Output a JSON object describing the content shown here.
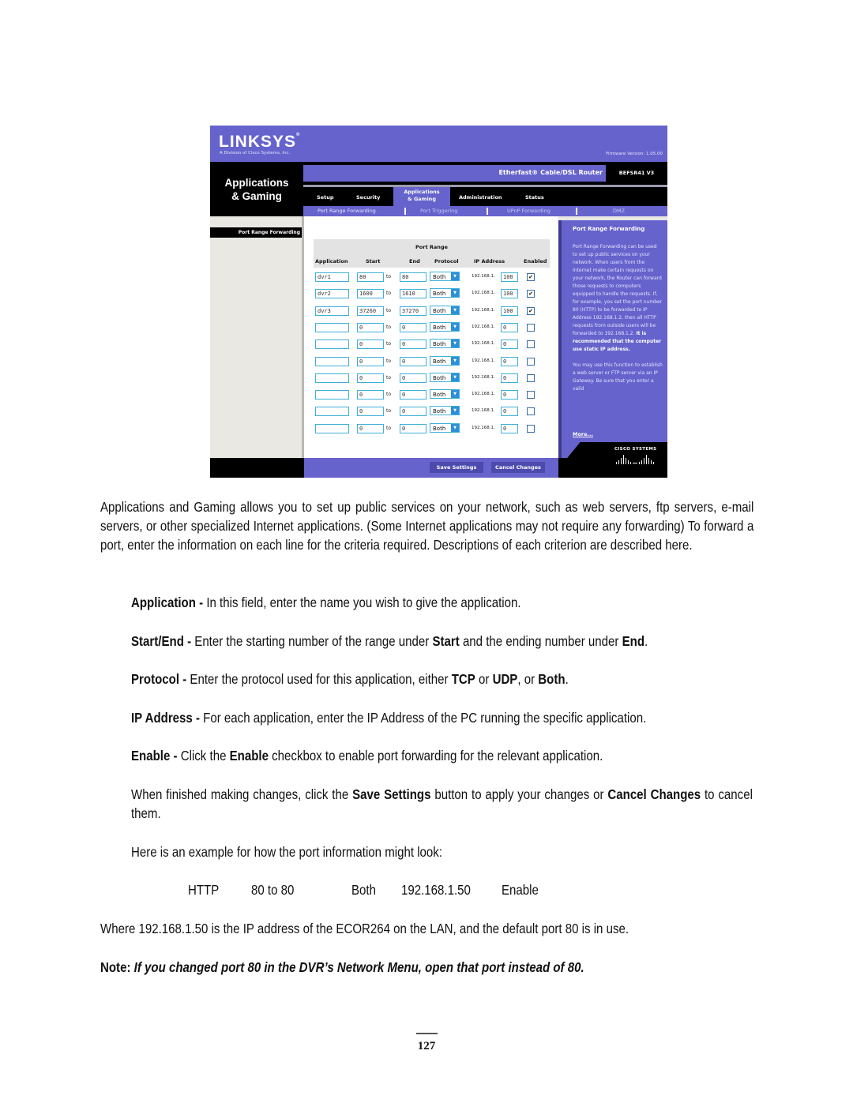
{
  "router_ui": {
    "brand": "LINKSYS",
    "brand_sub": "A Division of Cisco Systems, Inc.",
    "firmware": "Firmware Version: 1.05.00",
    "section_title_line1": "Applications",
    "section_title_line2": "& Gaming",
    "product_name": "Etherfast® Cable/DSL Router",
    "model": "BEFSR41 V3",
    "tabs": [
      {
        "label": "Setup",
        "active": false
      },
      {
        "label": "Security",
        "active": false
      },
      {
        "label_line1": "Applications",
        "label_line2": "& Gaming",
        "active": true
      },
      {
        "label": "Administration",
        "active": false
      },
      {
        "label": "Status",
        "active": false
      }
    ],
    "subtabs": [
      {
        "label": "Port Range Forwarding",
        "active": true
      },
      {
        "label": "Port Triggering",
        "active": false
      },
      {
        "label": "UPnP Forwarding",
        "active": false
      },
      {
        "label": "DMZ",
        "active": false
      }
    ],
    "left_label": "Port Range Forwarding",
    "table": {
      "group_header": "Port Range",
      "columns": [
        "Application",
        "Start",
        "End",
        "Protocol",
        "IP Address",
        "Enabled"
      ],
      "to_label": "to",
      "ip_prefix": "192.168.1.",
      "rows": [
        {
          "application": "dvr1",
          "start": "80",
          "end": "80",
          "protocol": "Both",
          "ip_last": "100",
          "enabled": true
        },
        {
          "application": "dvr2",
          "start": "1600",
          "end": "1610",
          "protocol": "Both",
          "ip_last": "100",
          "enabled": true
        },
        {
          "application": "dvr3",
          "start": "37260",
          "end": "37270",
          "protocol": "Both",
          "ip_last": "100",
          "enabled": true
        },
        {
          "application": "",
          "start": "0",
          "end": "0",
          "protocol": "Both",
          "ip_last": "0",
          "enabled": false
        },
        {
          "application": "",
          "start": "0",
          "end": "0",
          "protocol": "Both",
          "ip_last": "0",
          "enabled": false
        },
        {
          "application": "",
          "start": "0",
          "end": "0",
          "protocol": "Both",
          "ip_last": "0",
          "enabled": false
        },
        {
          "application": "",
          "start": "0",
          "end": "0",
          "protocol": "Both",
          "ip_last": "0",
          "enabled": false
        },
        {
          "application": "",
          "start": "0",
          "end": "0",
          "protocol": "Both",
          "ip_last": "0",
          "enabled": false
        },
        {
          "application": "",
          "start": "0",
          "end": "0",
          "protocol": "Both",
          "ip_last": "0",
          "enabled": false
        },
        {
          "application": "",
          "start": "0",
          "end": "0",
          "protocol": "Both",
          "ip_last": "0",
          "enabled": false
        }
      ]
    },
    "help": {
      "title": "Port Range Forwarding",
      "text_normal": "Port Range Forwarding can be used to set up public services on your network. When users from the Internet make certain requests on your network, the Router can forward those requests to computers equipped to handle the requests. If, for example, you set the port number 80 (HTTP) to be forwarded to IP Address 192.168.1.2, then all HTTP requests from outside users will be forwarded to 192.168.1.2.",
      "text_bold": "It is recommended that the computer use static IP address.",
      "text_2": "You may use this function to establish a web server or FTP server via an IP Gateway. Be sure that you enter a valid",
      "more": "More..."
    },
    "cisco_label": "CISCO SYSTEMS",
    "save_button": "Save Settings",
    "cancel_button": "Cancel Changes",
    "colors": {
      "brand_purple": "#6663cc",
      "header_black": "#000000",
      "field_border": "#3fb0d8"
    }
  },
  "document": {
    "intro": "Applications and Gaming allows you to set up public services on your network, such as web servers, ftp servers, e-mail servers, or other specialized Internet applications. (Some Internet applications may not require any forwarding) To forward a port, enter the information on each line for the criteria required. Descriptions of each criterion are described here.",
    "items": [
      {
        "term": "Application -",
        "text": " In this field, enter the name you wish to give the application."
      },
      {
        "term": "Start/End -",
        "text_a": " Enter the starting number of the range under ",
        "b1": "Start",
        "text_b": " and the ending number under ",
        "b2": "End",
        "text_c": "."
      },
      {
        "term": "Protocol -",
        "text_a": " Enter the protocol used for this application, either ",
        "b1": "TCP",
        "text_b": " or ",
        "b2": "UDP",
        "text_c": ", or ",
        "b3": "Both",
        "text_d": "."
      },
      {
        "term": "IP Address -",
        "text": " For each application, enter the IP Address of the PC running the specific application."
      },
      {
        "term": "Enable -",
        "text_a": " Click the ",
        "b1": "Enable",
        "text_b": " checkbox to enable port forwarding for the relevant application."
      }
    ],
    "finish_a": "When finished making changes, click the ",
    "finish_b1": "Save Settings",
    "finish_b": " button to apply your changes or ",
    "finish_b2": "Cancel Changes",
    "finish_c": " to cancel them.",
    "example_intro": "Here is an example for how the port information might look:",
    "example": {
      "app": "HTTP",
      "ports": "80 to 80",
      "protocol": "Both",
      "ip": "192.168.1.50",
      "enable": "Enable"
    },
    "where": "Where 192.168.1.50 is the IP address of the ECOR264 on the LAN, and the default port 80 is in use.",
    "note_label": "Note:",
    "note_text": " If you changed port 80 in the DVR’s Network Menu, open that port instead of 80.",
    "page_number": "127"
  }
}
